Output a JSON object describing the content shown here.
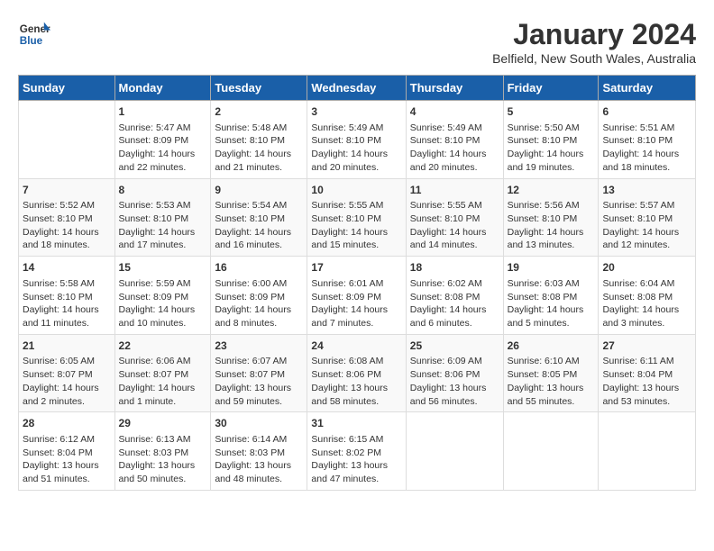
{
  "logo": {
    "line1": "General",
    "line2": "Blue"
  },
  "title": "January 2024",
  "subtitle": "Belfield, New South Wales, Australia",
  "weekdays": [
    "Sunday",
    "Monday",
    "Tuesday",
    "Wednesday",
    "Thursday",
    "Friday",
    "Saturday"
  ],
  "weeks": [
    [
      {
        "day": "",
        "info": ""
      },
      {
        "day": "1",
        "info": "Sunrise: 5:47 AM\nSunset: 8:09 PM\nDaylight: 14 hours\nand 22 minutes."
      },
      {
        "day": "2",
        "info": "Sunrise: 5:48 AM\nSunset: 8:10 PM\nDaylight: 14 hours\nand 21 minutes."
      },
      {
        "day": "3",
        "info": "Sunrise: 5:49 AM\nSunset: 8:10 PM\nDaylight: 14 hours\nand 20 minutes."
      },
      {
        "day": "4",
        "info": "Sunrise: 5:49 AM\nSunset: 8:10 PM\nDaylight: 14 hours\nand 20 minutes."
      },
      {
        "day": "5",
        "info": "Sunrise: 5:50 AM\nSunset: 8:10 PM\nDaylight: 14 hours\nand 19 minutes."
      },
      {
        "day": "6",
        "info": "Sunrise: 5:51 AM\nSunset: 8:10 PM\nDaylight: 14 hours\nand 18 minutes."
      }
    ],
    [
      {
        "day": "7",
        "info": "Sunrise: 5:52 AM\nSunset: 8:10 PM\nDaylight: 14 hours\nand 18 minutes."
      },
      {
        "day": "8",
        "info": "Sunrise: 5:53 AM\nSunset: 8:10 PM\nDaylight: 14 hours\nand 17 minutes."
      },
      {
        "day": "9",
        "info": "Sunrise: 5:54 AM\nSunset: 8:10 PM\nDaylight: 14 hours\nand 16 minutes."
      },
      {
        "day": "10",
        "info": "Sunrise: 5:55 AM\nSunset: 8:10 PM\nDaylight: 14 hours\nand 15 minutes."
      },
      {
        "day": "11",
        "info": "Sunrise: 5:55 AM\nSunset: 8:10 PM\nDaylight: 14 hours\nand 14 minutes."
      },
      {
        "day": "12",
        "info": "Sunrise: 5:56 AM\nSunset: 8:10 PM\nDaylight: 14 hours\nand 13 minutes."
      },
      {
        "day": "13",
        "info": "Sunrise: 5:57 AM\nSunset: 8:10 PM\nDaylight: 14 hours\nand 12 minutes."
      }
    ],
    [
      {
        "day": "14",
        "info": "Sunrise: 5:58 AM\nSunset: 8:10 PM\nDaylight: 14 hours\nand 11 minutes."
      },
      {
        "day": "15",
        "info": "Sunrise: 5:59 AM\nSunset: 8:09 PM\nDaylight: 14 hours\nand 10 minutes."
      },
      {
        "day": "16",
        "info": "Sunrise: 6:00 AM\nSunset: 8:09 PM\nDaylight: 14 hours\nand 8 minutes."
      },
      {
        "day": "17",
        "info": "Sunrise: 6:01 AM\nSunset: 8:09 PM\nDaylight: 14 hours\nand 7 minutes."
      },
      {
        "day": "18",
        "info": "Sunrise: 6:02 AM\nSunset: 8:08 PM\nDaylight: 14 hours\nand 6 minutes."
      },
      {
        "day": "19",
        "info": "Sunrise: 6:03 AM\nSunset: 8:08 PM\nDaylight: 14 hours\nand 5 minutes."
      },
      {
        "day": "20",
        "info": "Sunrise: 6:04 AM\nSunset: 8:08 PM\nDaylight: 14 hours\nand 3 minutes."
      }
    ],
    [
      {
        "day": "21",
        "info": "Sunrise: 6:05 AM\nSunset: 8:07 PM\nDaylight: 14 hours\nand 2 minutes."
      },
      {
        "day": "22",
        "info": "Sunrise: 6:06 AM\nSunset: 8:07 PM\nDaylight: 14 hours\nand 1 minute."
      },
      {
        "day": "23",
        "info": "Sunrise: 6:07 AM\nSunset: 8:07 PM\nDaylight: 13 hours\nand 59 minutes."
      },
      {
        "day": "24",
        "info": "Sunrise: 6:08 AM\nSunset: 8:06 PM\nDaylight: 13 hours\nand 58 minutes."
      },
      {
        "day": "25",
        "info": "Sunrise: 6:09 AM\nSunset: 8:06 PM\nDaylight: 13 hours\nand 56 minutes."
      },
      {
        "day": "26",
        "info": "Sunrise: 6:10 AM\nSunset: 8:05 PM\nDaylight: 13 hours\nand 55 minutes."
      },
      {
        "day": "27",
        "info": "Sunrise: 6:11 AM\nSunset: 8:04 PM\nDaylight: 13 hours\nand 53 minutes."
      }
    ],
    [
      {
        "day": "28",
        "info": "Sunrise: 6:12 AM\nSunset: 8:04 PM\nDaylight: 13 hours\nand 51 minutes."
      },
      {
        "day": "29",
        "info": "Sunrise: 6:13 AM\nSunset: 8:03 PM\nDaylight: 13 hours\nand 50 minutes."
      },
      {
        "day": "30",
        "info": "Sunrise: 6:14 AM\nSunset: 8:03 PM\nDaylight: 13 hours\nand 48 minutes."
      },
      {
        "day": "31",
        "info": "Sunrise: 6:15 AM\nSunset: 8:02 PM\nDaylight: 13 hours\nand 47 minutes."
      },
      {
        "day": "",
        "info": ""
      },
      {
        "day": "",
        "info": ""
      },
      {
        "day": "",
        "info": ""
      }
    ]
  ]
}
